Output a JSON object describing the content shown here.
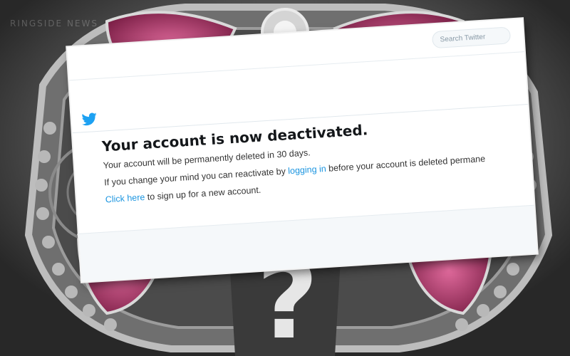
{
  "watermark": "RINGSIDE NEWS",
  "background": {
    "question_mark": "?"
  },
  "card": {
    "search": {
      "placeholder": "Search Twitter"
    },
    "logo_icon": "twitter-bird-icon",
    "message": {
      "title": "Your account is now deactivated.",
      "line1": "Your account will be permanently deleted in 30 days.",
      "line2_prefix": "If you change your mind you can reactivate by ",
      "line2_link": "logging in",
      "line2_suffix": " before your account is deleted permane",
      "line3_link": "Click here",
      "line3_suffix": " to sign up for a new account."
    }
  },
  "colors": {
    "link": "#1b95e0",
    "twitter_blue": "#1da1f2",
    "belt_pink": "#c8407a"
  }
}
